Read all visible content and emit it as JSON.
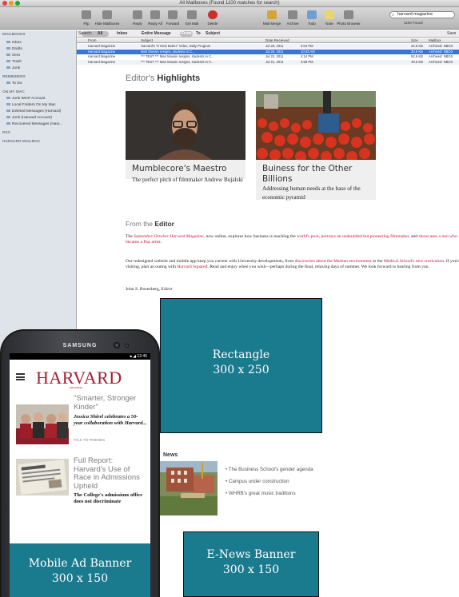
{
  "window": {
    "title": "All Mailboxes (Found 1100 matches for search)",
    "accent": "#3875d7"
  },
  "toolbar": {
    "buttons": [
      "Filp",
      "Hide Mailboxes",
      "Reply",
      "Reply All",
      "Forward",
      "Get Mail",
      "Delete",
      "Mail Merge",
      "Archive",
      "Todo",
      "Note",
      "Photo Browser"
    ],
    "search_value": "harvard magazine",
    "search_caption": "1100 Found"
  },
  "sidebar": {
    "items": [
      {
        "label": "MAILBOXES",
        "kind": "head"
      },
      {
        "label": "Inbox",
        "kind": "item"
      },
      {
        "label": "Drafts",
        "kind": "item"
      },
      {
        "label": "Sent",
        "kind": "item"
      },
      {
        "label": "Trash",
        "kind": "item"
      },
      {
        "label": "Junk",
        "kind": "item"
      },
      {
        "label": "REMINDERS",
        "kind": "head"
      },
      {
        "label": "To Do",
        "kind": "item"
      },
      {
        "label": "ON MY MAC",
        "kind": "head"
      },
      {
        "label": "Junk IMAP Account",
        "kind": "item"
      },
      {
        "label": "Local Folders On My Mac",
        "kind": "item"
      },
      {
        "label": "Deleted Messages (Harvard)",
        "kind": "item"
      },
      {
        "label": "Junk (Harvard Account)",
        "kind": "item"
      },
      {
        "label": "Recovered Messages (Harv...",
        "kind": "item"
      },
      {
        "label": "RSS",
        "kind": "head"
      },
      {
        "label": "HARVARD MAILBOX",
        "kind": "head"
      }
    ]
  },
  "filterbar": {
    "items": [
      "Search:",
      "All",
      "Inbox",
      "Entire Message",
      "From",
      "To",
      "Subject",
      "Save"
    ]
  },
  "message_list": {
    "columns": [
      "From",
      "Subject",
      "Date Received",
      "Size",
      "Mailbox"
    ],
    "rows": [
      {
        "from": "Harvard Magazine",
        "subject": "Harvard's \"It Gets Better\" Video, Daily Program",
        "date": "Jul 29, 2011",
        "time": "3:04 PM",
        "size": "24.8 KB",
        "mailbox": "Archived: NBOX",
        "state": "alt"
      },
      {
        "from": "Harvard Magazine",
        "subject": "Mari Mousin resigns, students in C...",
        "date": "Jul 26, 2011",
        "time": "10:43 AM",
        "size": "30.6 KB",
        "mailbox": "Archived: NBOX",
        "state": "sel"
      },
      {
        "from": "Harvard Magazine",
        "subject": "*** TEST *** Mari Mousin resigns, students in C...",
        "date": "Jul 22, 2011",
        "time": "4:14 PM",
        "size": "52.6 KB",
        "mailbox": "Archived: NBOX",
        "state": "norm"
      },
      {
        "from": "Harvard Magazine",
        "subject": "*** TEST *** Mari Mousin resigns, students in C...",
        "date": "Jul 21, 2011",
        "time": "3:58 PM",
        "size": "49.6 KB",
        "mailbox": "Archived: NBOX",
        "state": "alt"
      }
    ]
  },
  "email": {
    "highlights_prefix": "Editor's",
    "highlights_bold": "Highlights",
    "cards": [
      {
        "title": "Mumblecore's Maestro",
        "desc": "The perfect pitch of filmmaker Andrew Bujalski"
      },
      {
        "title": "Buiness for the Other Billions",
        "desc": "Addressing human needs at the base of the economic pyramid"
      }
    ],
    "editor_prefix": "From the",
    "editor_bold": "Editor",
    "para1": {
      "t1": "The ",
      "l1": "September-October Harvard Magazine",
      "t2": ", now online, explores how business is reaching the ",
      "l2": "world's poor",
      "t3": ", ",
      "l3": "portrays an underalded but pioneering filmmaker",
      "t4": ", and ",
      "l4": "showcases a nun who became a Pop artist",
      "t5": "."
    },
    "para2": {
      "t1": "Our redesigned website and mobile app keep you current with University developments, from ",
      "l1": "discoveries about the Martian environment",
      "t2": " to the ",
      "l2": "Medical School's new curriculum",
      "t3": ". If you're visiting, plan an outing with ",
      "l3": "Harvard Squared",
      "t4": ". Read and enjoy when you wish—perhaps during the final, relaxing days of summer. We look forward to hearing from you."
    },
    "signature_name": "John S. Rosenberg, ",
    "signature_role": "Editor",
    "news_title": "News",
    "news_items": [
      "• The Business School's gender agenda",
      "• Campus under construction",
      "• WHRB's great music traditions"
    ]
  },
  "ads": {
    "rectangle": {
      "line1": "Rectangle",
      "line2": "300 x 250"
    },
    "enews": {
      "line1": "E-News Banner",
      "line2": "300 x 150"
    },
    "mobile": {
      "line1": "Mobile Ad Banner",
      "line2": "300 x 150"
    },
    "color": "#1a7a8e"
  },
  "phone": {
    "brand": "SAMSUNG",
    "status_time": "12:45",
    "logo": "HARVARD",
    "logo_sub": "MAGAZINE",
    "stories": [
      {
        "headline": "\"Smarter, Stronger Kinder\"",
        "summary": "Jessica Shirel celebrates a 50-year collaboration with Harvard...",
        "meta": "TALK TO FRIENDS"
      },
      {
        "headline": "Full Report: Harvard's Use of Race in Admissions Upheld",
        "summary": "The College's admissions office does not discriminate"
      }
    ]
  }
}
